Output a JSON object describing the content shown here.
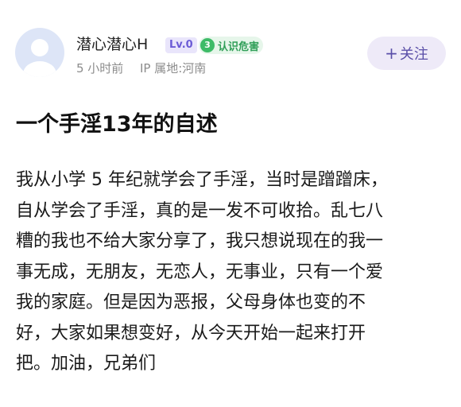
{
  "user": {
    "name": "潜心潜心H",
    "level": "Lv.0",
    "cert_level": "3",
    "cert_label": "认识危害",
    "time": "5 小时前",
    "ip": "IP 属地:河南",
    "follow_label": "关注"
  },
  "post": {
    "title": "一个手淫13年的自述",
    "lines": [
      "我从小学 5 年纪就学会了手淫，当时是蹭蹭床，",
      "自从学会了手淫，真的是一发不可收拾。乱七八",
      "糟的我也不给大家分享了，我只想说现在的我一",
      "事无成，无朋友，无恋人，无事业，只有一个爱",
      "我的家庭。但是因为恶报，父母身体也变的不",
      "好，大家如果想变好，从今天开始一起来打开",
      "把。加油，兄弟们"
    ]
  },
  "colors": {
    "level_badge": "#6b5bd6",
    "cert_badge": "#3dbb67",
    "follow_button_bg": "#eeeaf8",
    "avatar_bg": "#dde5f7"
  },
  "icons": {
    "avatar": "default-avatar-icon",
    "follow": "plus-icon"
  }
}
